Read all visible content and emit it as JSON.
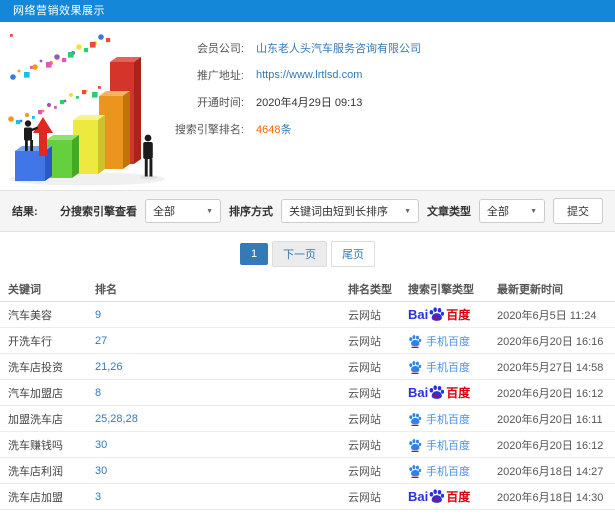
{
  "header": {
    "title": "网络营销效果展示"
  },
  "info": {
    "rows": [
      {
        "label": "会员公司:",
        "value": "山东老人头汽车服务咨询有限公司"
      },
      {
        "label": "推广地址:",
        "value": "https://www.lrtlsd.com"
      },
      {
        "label": "开通时间:",
        "value": "2020年4月29日 09:13"
      },
      {
        "label": "搜索引擎排名:",
        "value": "4648",
        "suffix": "条"
      }
    ]
  },
  "filters": {
    "result_label": "结果:",
    "engine_label": "分搜索引擎查看",
    "engine_value": "全部",
    "sort_label": "排序方式",
    "sort_value": "关键词由短到长排序",
    "article_label": "文章类型",
    "article_value": "全部",
    "submit_label": "提交"
  },
  "pagination": {
    "current": "1",
    "next": "下一页",
    "last": "尾页"
  },
  "table": {
    "headers": [
      "关键词",
      "排名",
      "排名类型",
      "搜索引擎类型",
      "最新更新时间"
    ],
    "engines": {
      "baidu": {
        "style": "logo",
        "prefix": "Bai",
        "paw_text": "du",
        "label": "百度"
      },
      "mobile-baidu": {
        "style": "icon-text",
        "label": "手机百度"
      }
    },
    "rows": [
      {
        "keyword": "汽车美容",
        "rank": "9",
        "rank_type": "云网站",
        "engine": "baidu",
        "updated": "2020年6月5日 11:24"
      },
      {
        "keyword": "开洗车行",
        "rank": "27",
        "rank_type": "云网站",
        "engine": "mobile-baidu",
        "updated": "2020年6月20日 16:16"
      },
      {
        "keyword": "洗车店投资",
        "rank": "21,26",
        "rank_type": "云网站",
        "engine": "mobile-baidu",
        "updated": "2020年5月27日 14:58"
      },
      {
        "keyword": "汽车加盟店",
        "rank": "8",
        "rank_type": "云网站",
        "engine": "baidu",
        "updated": "2020年6月20日 16:12"
      },
      {
        "keyword": "加盟洗车店",
        "rank": "25,28,28",
        "rank_type": "云网站",
        "engine": "mobile-baidu",
        "updated": "2020年6月20日 16:11"
      },
      {
        "keyword": "洗车赚钱吗",
        "rank": "30",
        "rank_type": "云网站",
        "engine": "mobile-baidu",
        "updated": "2020年6月20日 16:12"
      },
      {
        "keyword": "洗车店利润",
        "rank": "30",
        "rank_type": "云网站",
        "engine": "mobile-baidu",
        "updated": "2020年6月18日 14:27"
      },
      {
        "keyword": "洗车店加盟",
        "rank": "3",
        "rank_type": "云网站",
        "engine": "baidu",
        "updated": "2020年6月18日 14:30"
      }
    ]
  },
  "colors": {
    "topbar_blue": "#1487d8",
    "link_blue": "#337ab7",
    "highlight_orange": "#ff6600",
    "baidu_blue": "#2932e1",
    "baidu_red": "#d7000f",
    "mobile_baidu_blue": "#4a90e2",
    "pagination_active_blue": "#337ab7"
  }
}
